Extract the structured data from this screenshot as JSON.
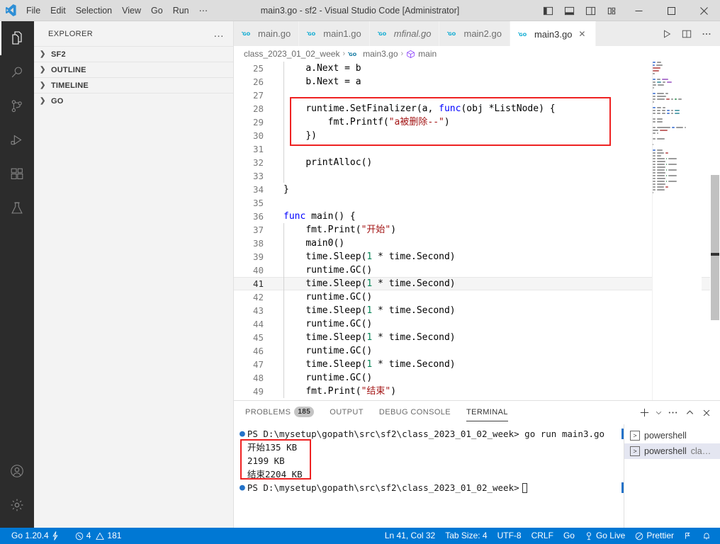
{
  "window": {
    "title": "main3.go - sf2 - Visual Studio Code [Administrator]",
    "menu": [
      "File",
      "Edit",
      "Selection",
      "View",
      "Go",
      "Run",
      "⋯"
    ],
    "layout_buttons": [
      "toggle-primary-sidebar",
      "toggle-panel",
      "toggle-secondary-sidebar",
      "customize-layout"
    ],
    "window_buttons": {
      "minimize": "─",
      "maximize": "☐",
      "close": "✕"
    }
  },
  "activitybar": {
    "items": [
      {
        "name": "explorer",
        "active": true
      },
      {
        "name": "search",
        "active": false
      },
      {
        "name": "source-control",
        "active": false
      },
      {
        "name": "run-and-debug",
        "active": false
      },
      {
        "name": "extensions",
        "active": false
      },
      {
        "name": "testing",
        "active": false
      }
    ],
    "bottom_items": [
      {
        "name": "accounts"
      },
      {
        "name": "manage-settings"
      }
    ]
  },
  "sidebar": {
    "title": "EXPLORER",
    "more_actions": "…",
    "sections": [
      {
        "label": "SF2",
        "expanded": false
      },
      {
        "label": "OUTLINE",
        "expanded": false
      },
      {
        "label": "TIMELINE",
        "expanded": false
      },
      {
        "label": "GO",
        "expanded": false
      }
    ]
  },
  "editor": {
    "tabs": [
      {
        "label": "main.go",
        "active": false,
        "italic": false,
        "icon": "go-icon"
      },
      {
        "label": "main1.go",
        "active": false,
        "italic": false,
        "icon": "go-icon"
      },
      {
        "label": "mfinal.go",
        "active": false,
        "italic": true,
        "icon": "go-icon"
      },
      {
        "label": "main2.go",
        "active": false,
        "italic": false,
        "icon": "go-icon"
      },
      {
        "label": "main3.go",
        "active": true,
        "italic": false,
        "icon": "go-icon"
      }
    ],
    "tab_close_label": "✕",
    "tab_actions": [
      "run-code-button",
      "split-editor-button",
      "more-actions-button"
    ],
    "breadcrumb": [
      "class_2023_01_02_week",
      "main3.go",
      "main"
    ],
    "breadcrumb_separator": "›",
    "first_visible_line": 25,
    "current_line": 41,
    "code_lines": [
      {
        "n": 25,
        "indent": 1,
        "tokens": [
          {
            "t": "a.Next ",
            "c": "punct"
          },
          {
            "t": "= ",
            "c": "punct"
          },
          {
            "t": "b",
            "c": "punct"
          }
        ]
      },
      {
        "n": 26,
        "indent": 1,
        "tokens": [
          {
            "t": "b.Next ",
            "c": "punct"
          },
          {
            "t": "= ",
            "c": "punct"
          },
          {
            "t": "a",
            "c": "punct"
          }
        ]
      },
      {
        "n": 27,
        "indent": 1,
        "tokens": []
      },
      {
        "n": 28,
        "indent": 1,
        "tokens": [
          {
            "t": "runtime.SetFinalizer(a, ",
            "c": "punct"
          },
          {
            "t": "func",
            "c": "kw"
          },
          {
            "t": "(obj *",
            "c": "punct"
          },
          {
            "t": "ListNode",
            "c": "punct"
          },
          {
            "t": ") {",
            "c": "punct"
          }
        ]
      },
      {
        "n": 29,
        "indent": 2,
        "tokens": [
          {
            "t": "fmt.Printf(",
            "c": "punct"
          },
          {
            "t": "\"a被删除--\"",
            "c": "str"
          },
          {
            "t": ")",
            "c": "punct"
          }
        ]
      },
      {
        "n": 30,
        "indent": 1,
        "tokens": [
          {
            "t": "})",
            "c": "punct"
          }
        ]
      },
      {
        "n": 31,
        "indent": 1,
        "tokens": []
      },
      {
        "n": 32,
        "indent": 1,
        "tokens": [
          {
            "t": "printAlloc()",
            "c": "punct"
          }
        ]
      },
      {
        "n": 33,
        "indent": 1,
        "tokens": []
      },
      {
        "n": 34,
        "indent": 0,
        "tokens": [
          {
            "t": "}",
            "c": "punct"
          }
        ]
      },
      {
        "n": 35,
        "indent": 0,
        "tokens": []
      },
      {
        "n": 36,
        "indent": 0,
        "tokens": [
          {
            "t": "func",
            "c": "kw"
          },
          {
            "t": " main() {",
            "c": "punct"
          }
        ]
      },
      {
        "n": 37,
        "indent": 1,
        "tokens": [
          {
            "t": "fmt.Print(",
            "c": "punct"
          },
          {
            "t": "\"开始\"",
            "c": "str"
          },
          {
            "t": ")",
            "c": "punct"
          }
        ]
      },
      {
        "n": 38,
        "indent": 1,
        "tokens": [
          {
            "t": "main0()",
            "c": "punct"
          }
        ]
      },
      {
        "n": 39,
        "indent": 1,
        "tokens": [
          {
            "t": "time.Sleep(",
            "c": "punct"
          },
          {
            "t": "1",
            "c": "num"
          },
          {
            "t": " * time.Second)",
            "c": "punct"
          }
        ]
      },
      {
        "n": 40,
        "indent": 1,
        "tokens": [
          {
            "t": "runtime.GC()",
            "c": "punct"
          }
        ]
      },
      {
        "n": 41,
        "indent": 1,
        "tokens": [
          {
            "t": "time.Sleep(",
            "c": "punct"
          },
          {
            "t": "1",
            "c": "num"
          },
          {
            "t": " * time.Second)",
            "c": "punct"
          }
        ]
      },
      {
        "n": 42,
        "indent": 1,
        "tokens": [
          {
            "t": "runtime.GC()",
            "c": "punct"
          }
        ]
      },
      {
        "n": 43,
        "indent": 1,
        "tokens": [
          {
            "t": "time.Sleep(",
            "c": "punct"
          },
          {
            "t": "1",
            "c": "num"
          },
          {
            "t": " * time.Second)",
            "c": "punct"
          }
        ]
      },
      {
        "n": 44,
        "indent": 1,
        "tokens": [
          {
            "t": "runtime.GC()",
            "c": "punct"
          }
        ]
      },
      {
        "n": 45,
        "indent": 1,
        "tokens": [
          {
            "t": "time.Sleep(",
            "c": "punct"
          },
          {
            "t": "1",
            "c": "num"
          },
          {
            "t": " * time.Second)",
            "c": "punct"
          }
        ]
      },
      {
        "n": 46,
        "indent": 1,
        "tokens": [
          {
            "t": "runtime.GC()",
            "c": "punct"
          }
        ]
      },
      {
        "n": 47,
        "indent": 1,
        "tokens": [
          {
            "t": "time.Sleep(",
            "c": "punct"
          },
          {
            "t": "1",
            "c": "num"
          },
          {
            "t": " * time.Second)",
            "c": "punct"
          }
        ]
      },
      {
        "n": 48,
        "indent": 1,
        "tokens": [
          {
            "t": "runtime.GC()",
            "c": "punct"
          }
        ]
      },
      {
        "n": 49,
        "indent": 1,
        "tokens": [
          {
            "t": "fmt.Print(",
            "c": "punct"
          },
          {
            "t": "\"结束\"",
            "c": "str"
          },
          {
            "t": ")",
            "c": "punct"
          }
        ]
      }
    ],
    "annotation_color": "#ee2222"
  },
  "panel": {
    "tabs": [
      {
        "label": "PROBLEMS",
        "badge": "185",
        "active": false
      },
      {
        "label": "OUTPUT",
        "badge": null,
        "active": false
      },
      {
        "label": "DEBUG CONSOLE",
        "badge": null,
        "active": false
      },
      {
        "label": "TERMINAL",
        "badge": null,
        "active": true
      }
    ],
    "actions": [
      "new-terminal-button",
      "terminal-profile-chevron",
      "views-and-more-button",
      "maximize-panel-button",
      "close-panel-button"
    ],
    "terminal_lines": [
      {
        "type": "prompt",
        "prompt": "PS D:\\mysetup\\gopath\\src\\sf2\\class_2023_01_02_week>",
        "command": " go run main3.go"
      },
      {
        "type": "output",
        "text": "开始135 KB"
      },
      {
        "type": "output",
        "text": "2199 KB"
      },
      {
        "type": "output",
        "text": "结束2204 KB"
      },
      {
        "type": "prompt",
        "prompt": "PS D:\\mysetup\\gopath\\src\\sf2\\class_2023_01_02_week>",
        "command": ""
      }
    ],
    "terminal_instances": [
      {
        "label": "powershell",
        "suffix": "",
        "selected": false
      },
      {
        "label": "powershell",
        "suffix": "cla…",
        "selected": true
      }
    ]
  },
  "statusbar": {
    "background": "#0078d4",
    "left": [
      {
        "name": "go-version",
        "text": "Go 1.20.4",
        "icon": "go-lightning-icon"
      },
      {
        "name": "problems",
        "text": "4",
        "text2": "181",
        "icon": "error-warning-icon"
      }
    ],
    "right": [
      {
        "name": "editor-position",
        "text": "Ln 41, Col 32"
      },
      {
        "name": "indentation",
        "text": "Tab Size: 4"
      },
      {
        "name": "encoding",
        "text": "UTF-8"
      },
      {
        "name": "eol",
        "text": "CRLF"
      },
      {
        "name": "language-mode",
        "text": "Go"
      },
      {
        "name": "go-live",
        "text": "Go Live",
        "icon": "broadcast-icon"
      },
      {
        "name": "prettier",
        "text": "Prettier",
        "icon": "prettier-icon"
      },
      {
        "name": "remote-indicator",
        "text": "",
        "icon": "remote-icon"
      },
      {
        "name": "notifications",
        "text": "",
        "icon": "bell-icon"
      }
    ]
  }
}
